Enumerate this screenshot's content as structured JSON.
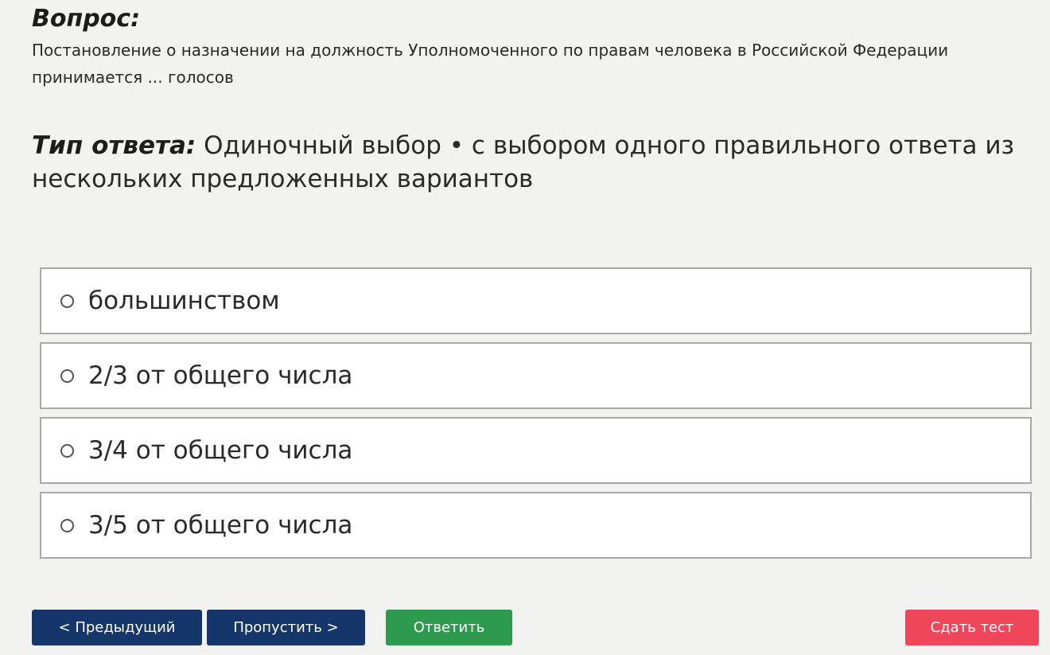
{
  "question": {
    "heading": "Вопрос:",
    "text": "Постановление о назначении на должность Уполномоченного по правам человека в Российской Федерации принимается ... голосов"
  },
  "answer_type": {
    "label": "Тип ответа:",
    "value": "Одиночный выбор • с выбором одного правильного ответа из нескольких предложенных вариантов"
  },
  "options": [
    {
      "label": "большинством"
    },
    {
      "label": "2/3 от общего числа"
    },
    {
      "label": "3/4 от общего числа"
    },
    {
      "label": "3/5 от общего числа"
    }
  ],
  "buttons": {
    "prev": "< Предыдущий",
    "skip": "Пропустить >",
    "answer": "Ответить",
    "submit": "Сдать тест"
  },
  "colors": {
    "nav_button": "#14366a",
    "answer_button": "#2d9a4e",
    "submit_button": "#f0465a"
  }
}
